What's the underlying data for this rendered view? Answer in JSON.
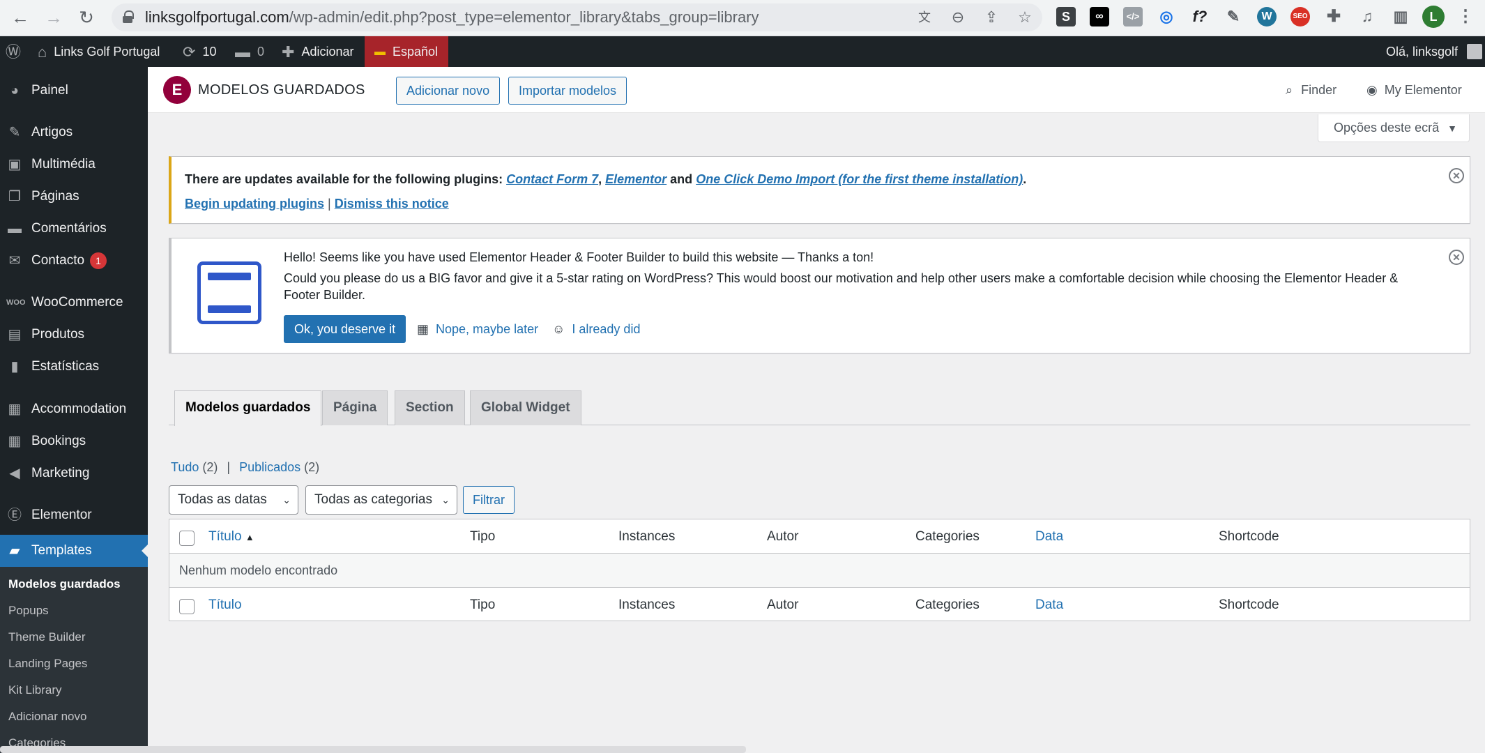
{
  "browser": {
    "url_host": "linksgolfportugal.com",
    "url_path": "/wp-admin/edit.php?post_type=elementor_library&tabs_group=library",
    "profile_initial": "L"
  },
  "adminbar": {
    "site_name": "Links Golf Portugal",
    "updates_count": "10",
    "comments_count": "0",
    "new_label": "Adicionar",
    "language_label": "Español",
    "greeting": "Olá, linksgolf"
  },
  "sidebar": {
    "items": [
      {
        "label": "Painel",
        "icon": "dashboard-icon"
      },
      {
        "label": "Artigos",
        "icon": "pin-icon"
      },
      {
        "label": "Multimédia",
        "icon": "media-icon"
      },
      {
        "label": "Páginas",
        "icon": "pages-icon"
      },
      {
        "label": "Comentários",
        "icon": "comments-icon"
      },
      {
        "label": "Contacto",
        "icon": "mail-icon",
        "badge": "1"
      },
      {
        "label": "WooCommerce",
        "icon": "woo-icon"
      },
      {
        "label": "Produtos",
        "icon": "archive-icon"
      },
      {
        "label": "Estatísticas",
        "icon": "chart-icon"
      },
      {
        "label": "Accommodation",
        "icon": "building-icon"
      },
      {
        "label": "Bookings",
        "icon": "calendar-icon"
      },
      {
        "label": "Marketing",
        "icon": "megaphone-icon"
      },
      {
        "label": "Elementor",
        "icon": "elementor-icon"
      },
      {
        "label": "Templates",
        "icon": "folder-icon"
      }
    ],
    "submenu": [
      "Modelos guardados",
      "Popups",
      "Theme Builder",
      "Landing Pages",
      "Kit Library",
      "Adicionar novo",
      "Categories"
    ]
  },
  "header": {
    "logo_letter": "E",
    "title": "MODELOS GUARDADOS",
    "add_new": "Adicionar novo",
    "import": "Importar modelos",
    "finder": "Finder",
    "my_elementor": "My Elementor",
    "screen_options": "Opções deste ecrã"
  },
  "notice_updates": {
    "text": "There are updates available for the following plugins:",
    "plugin1": "Contact Form 7",
    "plugin2": "Elementor",
    "and_word": "and",
    "plugin3": "One Click Demo Import (for the first theme installation)",
    "begin_updating": "Begin updating plugins",
    "dismiss": "Dismiss this notice"
  },
  "notice_hfe": {
    "line1": "Hello! Seems like you have used Elementor Header & Footer Builder to build this website — Thanks a ton!",
    "line2": "Could you please do us a BIG favor and give it a 5-star rating on WordPress? This would boost our motivation and help other users make a comfortable decision while choosing the Elementor Header &",
    "line3": "Footer Builder.",
    "ok_button": "Ok, you deserve it",
    "later": "Nope, maybe later",
    "already": "I already did"
  },
  "tabs": [
    "Modelos guardados",
    "Página",
    "Section",
    "Global Widget"
  ],
  "filters": {
    "all_label": "Tudo",
    "all_count": "(2)",
    "published_label": "Publicados",
    "published_count": "(2)",
    "dates_select": "Todas as datas",
    "categories_select": "Todas as categorias",
    "filter_button": "Filtrar"
  },
  "table": {
    "columns": [
      "Título",
      "Tipo",
      "Instances",
      "Autor",
      "Categories",
      "Data",
      "Shortcode"
    ],
    "empty_message": "Nenhum modelo encontrado"
  },
  "colors": {
    "wp_blue": "#2271b1",
    "admin_dark": "#1d2327",
    "elementor_brand": "#92003b",
    "warning": "#dba617",
    "language_bg": "#a7242a"
  }
}
